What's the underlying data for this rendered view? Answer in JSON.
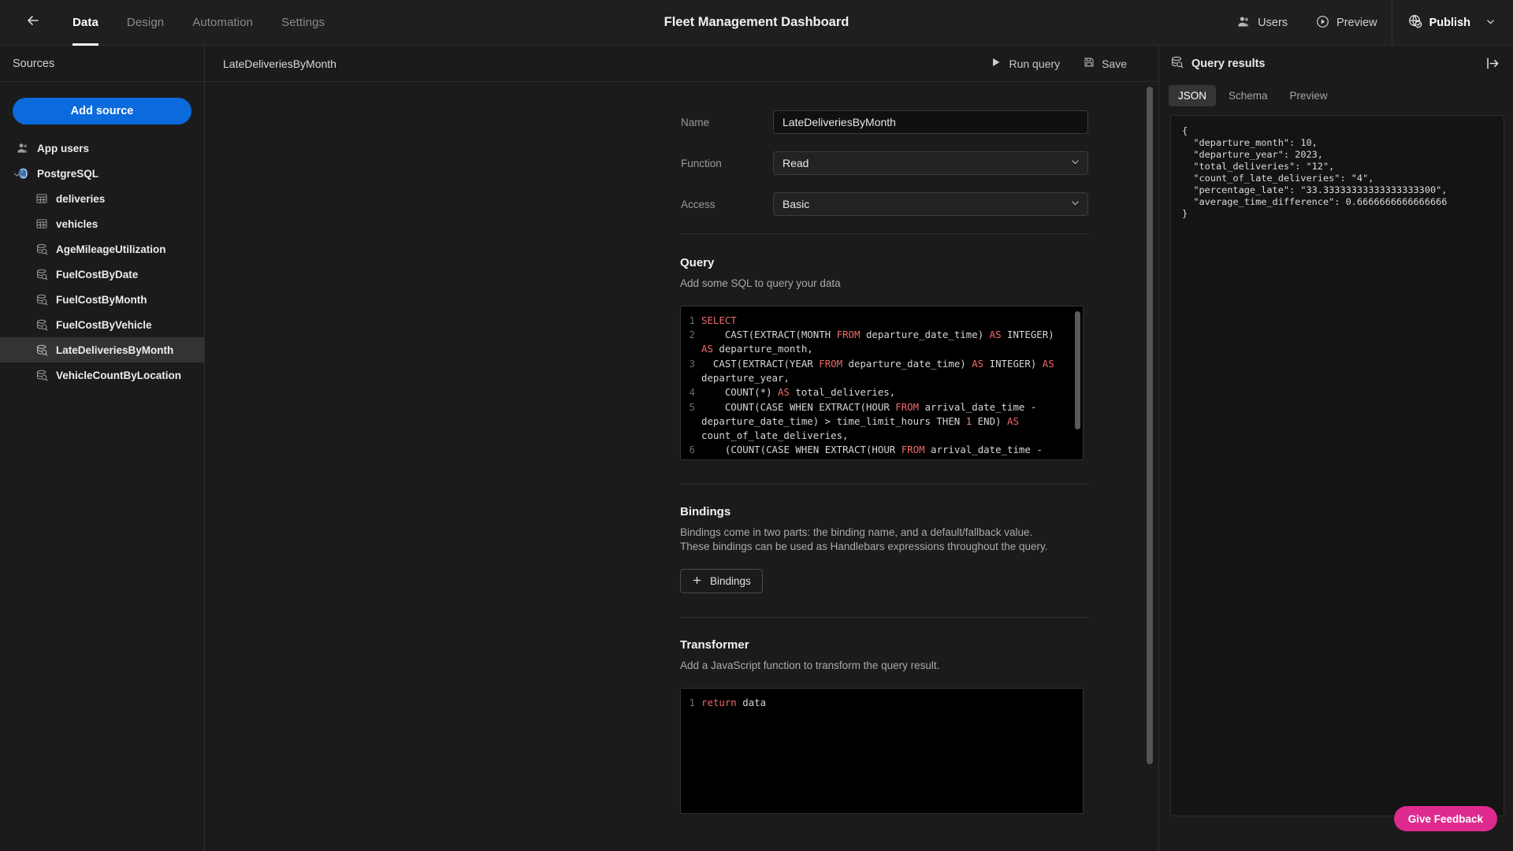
{
  "topbar": {
    "back_icon": "arrow-left-icon",
    "tabs": [
      {
        "label": "Data",
        "active": true
      },
      {
        "label": "Design",
        "active": false
      },
      {
        "label": "Automation",
        "active": false
      },
      {
        "label": "Settings",
        "active": false
      }
    ],
    "app_title": "Fleet Management Dashboard",
    "users_label": "Users",
    "preview_label": "Preview",
    "publish_label": "Publish"
  },
  "sidebar": {
    "header": "Sources",
    "add_source_label": "Add source",
    "items": [
      {
        "label": "App users",
        "icon": "users-icon",
        "level": 0,
        "selected": false
      },
      {
        "label": "PostgreSQL",
        "icon": "postgres-icon",
        "level": 0,
        "selected": false,
        "expanded": true
      },
      {
        "label": "deliveries",
        "icon": "table-icon",
        "level": 1,
        "selected": false
      },
      {
        "label": "vehicles",
        "icon": "table-icon",
        "level": 1,
        "selected": false
      },
      {
        "label": "AgeMileageUtilization",
        "icon": "query-icon",
        "level": 1,
        "selected": false
      },
      {
        "label": "FuelCostByDate",
        "icon": "query-icon",
        "level": 1,
        "selected": false
      },
      {
        "label": "FuelCostByMonth",
        "icon": "query-icon",
        "level": 1,
        "selected": false
      },
      {
        "label": "FuelCostByVehicle",
        "icon": "query-icon",
        "level": 1,
        "selected": false
      },
      {
        "label": "LateDeliveriesByMonth",
        "icon": "query-icon",
        "level": 1,
        "selected": true
      },
      {
        "label": "VehicleCountByLocation",
        "icon": "query-icon",
        "level": 1,
        "selected": false
      }
    ]
  },
  "main": {
    "breadcrumb": "LateDeliveriesByMonth",
    "run_query_label": "Run query",
    "save_label": "Save",
    "form": {
      "name_label": "Name",
      "name_value": "LateDeliveriesByMonth",
      "function_label": "Function",
      "function_value": "Read",
      "access_label": "Access",
      "access_value": "Basic"
    },
    "query": {
      "title": "Query",
      "subtitle": "Add some SQL to query your data",
      "lines": [
        {
          "n": "1",
          "t": "SELECT"
        },
        {
          "n": "2",
          "t": "    CAST(EXTRACT(MONTH FROM departure_date_time) AS INTEGER) AS departure_month,"
        },
        {
          "n": "3",
          "t": "  CAST(EXTRACT(YEAR FROM departure_date_time) AS INTEGER) AS departure_year,"
        },
        {
          "n": "4",
          "t": "    COUNT(*) AS total_deliveries,"
        },
        {
          "n": "5",
          "t": "    COUNT(CASE WHEN EXTRACT(HOUR FROM arrival_date_time - departure_date_time) > time_limit_hours THEN 1 END) AS count_of_late_deliveries,"
        },
        {
          "n": "6",
          "t": "    (COUNT(CASE WHEN EXTRACT(HOUR FROM arrival_date_time - departure_date_time) > time_limit_hours THEN 1"
        }
      ]
    },
    "bindings": {
      "title": "Bindings",
      "subtitle": "Bindings come in two parts: the binding name, and a default/fallback value. These bindings can be used as Handlebars expressions throughout the query.",
      "button_label": "Bindings"
    },
    "transformer": {
      "title": "Transformer",
      "subtitle": "Add a JavaScript function to transform the query result.",
      "lines": [
        {
          "n": "1",
          "t": "return data"
        }
      ]
    }
  },
  "right_panel": {
    "title": "Query results",
    "collapse_icon": "collapse-right-icon",
    "tabs": [
      {
        "label": "JSON",
        "active": true
      },
      {
        "label": "Schema",
        "active": false
      },
      {
        "label": "Preview",
        "active": false
      }
    ],
    "json_text": "{\n  \"departure_month\": 10,\n  \"departure_year\": 2023,\n  \"total_deliveries\": \"12\",\n  \"count_of_late_deliveries\": \"4\",\n  \"percentage_late\": \"33.33333333333333333300\",\n  \"average_time_difference\": 0.6666666666666666\n}",
    "feedback_label": "Give Feedback"
  },
  "colors": {
    "accent_blue": "#0b6bdd",
    "feedback_pink": "#de2a8f",
    "background": "#1b1b1b",
    "topbar": "#1f1f1f",
    "keyword_red": "#f06a6a"
  }
}
